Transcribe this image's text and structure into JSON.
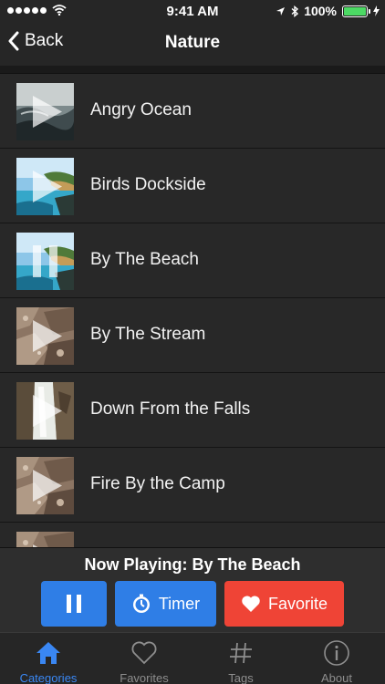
{
  "status": {
    "time": "9:41 AM",
    "battery": "100%",
    "battery_level": 1.0
  },
  "nav": {
    "back_label": "Back",
    "title": "Nature"
  },
  "tracks": [
    {
      "title": "Angry Ocean",
      "state": "play",
      "thumb": "ocean-dark"
    },
    {
      "title": "Birds Dockside",
      "state": "play",
      "thumb": "coast"
    },
    {
      "title": "By The Beach",
      "state": "pause",
      "thumb": "coast"
    },
    {
      "title": "By The Stream",
      "state": "play",
      "thumb": "rocks"
    },
    {
      "title": "Down From the Falls",
      "state": "play",
      "thumb": "falls"
    },
    {
      "title": "Fire By the Camp",
      "state": "play",
      "thumb": "rocks"
    },
    {
      "title": "",
      "state": "play",
      "thumb": "rocks"
    }
  ],
  "player": {
    "now_playing": "Now Playing: By The Beach",
    "timer_label": "Timer",
    "favorite_label": "Favorite"
  },
  "tabs": [
    {
      "label": "Categories",
      "icon": "house-icon",
      "active": true
    },
    {
      "label": "Favorites",
      "icon": "heart-outline-icon",
      "active": false
    },
    {
      "label": "Tags",
      "icon": "hashtag-icon",
      "active": false
    },
    {
      "label": "About",
      "icon": "info-circle-icon",
      "active": false
    }
  ],
  "colors": {
    "accent_blue": "#2f7ee6",
    "favorite_red": "#ef4436",
    "tab_active": "#3a87f3",
    "battery_green": "#4cd964"
  }
}
